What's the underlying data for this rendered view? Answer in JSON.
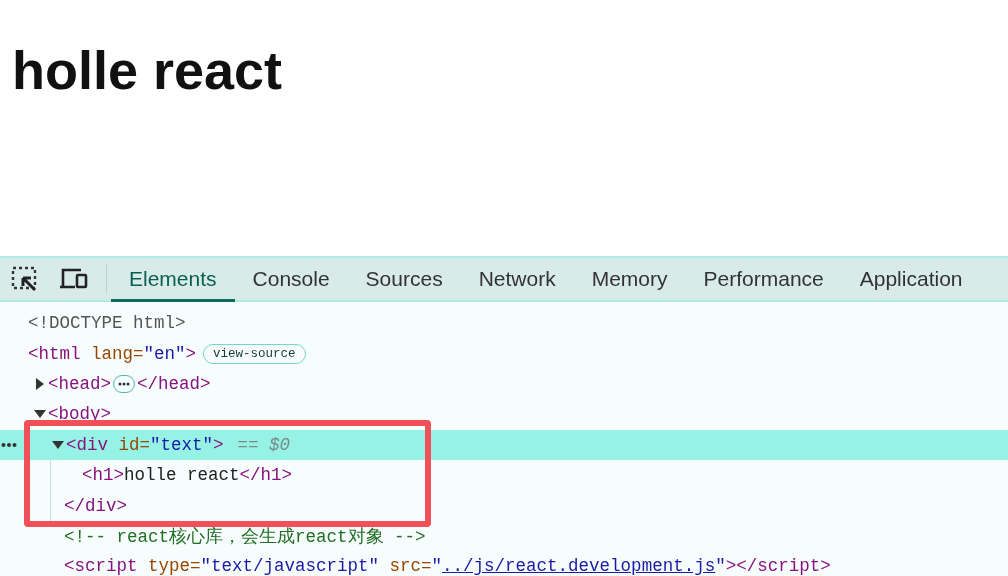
{
  "page": {
    "heading": "holle react"
  },
  "tabs": [
    {
      "label": "Elements",
      "selected": true
    },
    {
      "label": "Console",
      "selected": false
    },
    {
      "label": "Sources",
      "selected": false
    },
    {
      "label": "Network",
      "selected": false
    },
    {
      "label": "Memory",
      "selected": false
    },
    {
      "label": "Performance",
      "selected": false
    },
    {
      "label": "Application",
      "selected": false
    }
  ],
  "dom_tree": [
    {
      "selected": false,
      "parts": [
        {
          "kind": "doctype",
          "text": "<!DOCTYPE html>"
        }
      ]
    },
    {
      "selected": false,
      "parts": [
        {
          "kind": "tag",
          "text": "<html "
        },
        {
          "kind": "attr",
          "text": "lang="
        },
        {
          "kind": "value",
          "text": "\"en\""
        },
        {
          "kind": "tag",
          "text": ">"
        },
        {
          "kind": "badge",
          "text": "view-source"
        }
      ],
      "children": [
        {
          "selected": false,
          "expanded": false,
          "parts": [
            {
              "kind": "tag",
              "text": "<head>"
            },
            {
              "kind": "ellipsis"
            },
            {
              "kind": "tag",
              "text": "</head>"
            }
          ]
        },
        {
          "selected": false,
          "expanded": true,
          "parts": [
            {
              "kind": "tag",
              "text": "<body>"
            }
          ],
          "children": [
            {
              "selected": true,
              "expanded": true,
              "boxed": true,
              "parts": [
                {
                  "kind": "tag",
                  "text": "<div "
                },
                {
                  "kind": "attr",
                  "text": "id="
                },
                {
                  "kind": "value",
                  "text": "\"text\""
                },
                {
                  "kind": "tag",
                  "text": ">"
                },
                {
                  "kind": "marker",
                  "text": "== $0"
                }
              ],
              "children": [
                {
                  "selected": false,
                  "parts": [
                    {
                      "kind": "tag",
                      "text": "<h1>"
                    },
                    {
                      "kind": "text",
                      "text": "holle react"
                    },
                    {
                      "kind": "tag",
                      "text": "</h1>"
                    }
                  ]
                }
              ],
              "close": [
                {
                  "kind": "tag",
                  "text": "</div>"
                }
              ]
            },
            {
              "selected": false,
              "parts": [
                {
                  "kind": "comment",
                  "text": "<!-- react核心库，会生成react对象 -->"
                }
              ]
            },
            {
              "selected": false,
              "parts": [
                {
                  "kind": "tag",
                  "text": "<script "
                },
                {
                  "kind": "attr",
                  "text": "type="
                },
                {
                  "kind": "value",
                  "text": "\"text/javascript\""
                },
                {
                  "kind": "attr",
                  "text": " src="
                },
                {
                  "kind": "value",
                  "text": "\""
                },
                {
                  "kind": "link",
                  "text": "../js/react.development.js"
                },
                {
                  "kind": "value",
                  "text": "\""
                },
                {
                  "kind": "tag",
                  "text": "></script>"
                }
              ]
            }
          ]
        }
      ]
    }
  ]
}
